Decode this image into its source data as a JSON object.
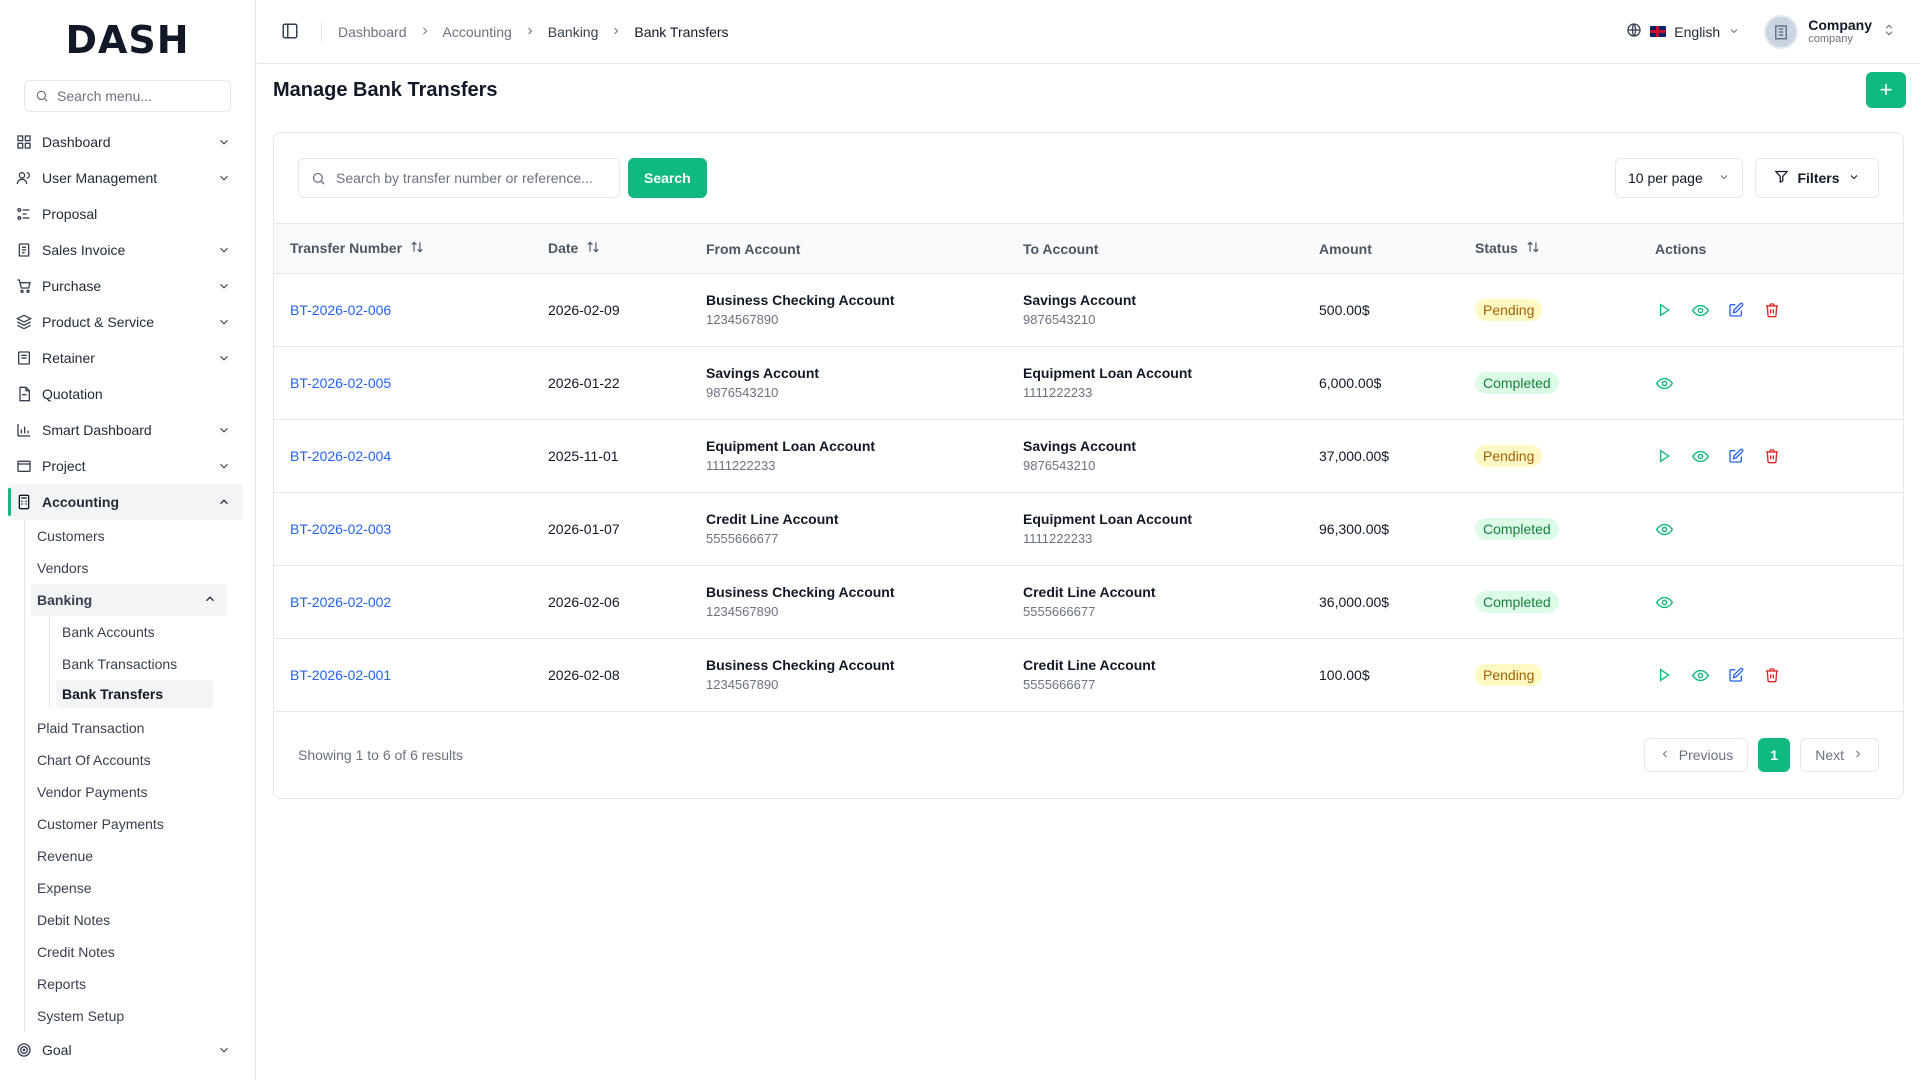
{
  "app": {
    "logo": "DASH"
  },
  "sidebar": {
    "search_placeholder": "Search menu...",
    "items": [
      {
        "label": "Dashboard",
        "icon": "dashboard-icon",
        "has_chevron": true
      },
      {
        "label": "User Management",
        "icon": "users-icon",
        "has_chevron": true
      },
      {
        "label": "Proposal",
        "icon": "proposal-icon",
        "has_chevron": false
      },
      {
        "label": "Sales Invoice",
        "icon": "invoice-icon",
        "has_chevron": true
      },
      {
        "label": "Purchase",
        "icon": "cart-icon",
        "has_chevron": true
      },
      {
        "label": "Product & Service",
        "icon": "layers-icon",
        "has_chevron": true
      },
      {
        "label": "Retainer",
        "icon": "retainer-icon",
        "has_chevron": true
      },
      {
        "label": "Quotation",
        "icon": "quotation-icon",
        "has_chevron": false
      },
      {
        "label": "Smart Dashboard",
        "icon": "chart-icon",
        "has_chevron": true
      },
      {
        "label": "Project",
        "icon": "folder-icon",
        "has_chevron": true
      },
      {
        "label": "Accounting",
        "icon": "calculator-icon",
        "has_chevron": true
      }
    ],
    "accounting_sub": {
      "customers": "Customers",
      "vendors": "Vendors",
      "banking": "Banking",
      "banking_sub": [
        "Bank Accounts",
        "Bank Transactions",
        "Bank Transfers"
      ],
      "rest": [
        "Plaid Transaction",
        "Chart Of Accounts",
        "Vendor Payments",
        "Customer Payments",
        "Revenue",
        "Expense",
        "Debit Notes",
        "Credit Notes",
        "Reports",
        "System Setup"
      ]
    },
    "goal": "Goal"
  },
  "header": {
    "breadcrumbs": [
      "Dashboard",
      "Accounting",
      "Banking",
      "Bank Transfers"
    ],
    "language": "English",
    "company_name": "Company",
    "company_role": "company"
  },
  "page": {
    "title": "Manage Bank Transfers",
    "add_label": "+",
    "search_placeholder": "Search by transfer number or reference...",
    "search_button": "Search",
    "per_page": "10 per page",
    "filters": "Filters"
  },
  "table": {
    "headers": {
      "transfer_number": "Transfer Number",
      "date": "Date",
      "from": "From Account",
      "to": "To Account",
      "amount": "Amount",
      "status": "Status",
      "actions": "Actions"
    },
    "rows": [
      {
        "number": "BT-2026-02-006",
        "date": "2026-02-09",
        "from_name": "Business Checking Account",
        "from_num": "1234567890",
        "to_name": "Savings Account",
        "to_num": "9876543210",
        "amount": "500.00$",
        "status": "Pending"
      },
      {
        "number": "BT-2026-02-005",
        "date": "2026-01-22",
        "from_name": "Savings Account",
        "from_num": "9876543210",
        "to_name": "Equipment Loan Account",
        "to_num": "1111222233",
        "amount": "6,000.00$",
        "status": "Completed"
      },
      {
        "number": "BT-2026-02-004",
        "date": "2025-11-01",
        "from_name": "Equipment Loan Account",
        "from_num": "1111222233",
        "to_name": "Savings Account",
        "to_num": "9876543210",
        "amount": "37,000.00$",
        "status": "Pending"
      },
      {
        "number": "BT-2026-02-003",
        "date": "2026-01-07",
        "from_name": "Credit Line Account",
        "from_num": "5555666677",
        "to_name": "Equipment Loan Account",
        "to_num": "1111222233",
        "amount": "96,300.00$",
        "status": "Completed"
      },
      {
        "number": "BT-2026-02-002",
        "date": "2026-02-06",
        "from_name": "Business Checking Account",
        "from_num": "1234567890",
        "to_name": "Credit Line Account",
        "to_num": "5555666677",
        "amount": "36,000.00$",
        "status": "Completed"
      },
      {
        "number": "BT-2026-02-001",
        "date": "2026-02-08",
        "from_name": "Business Checking Account",
        "from_num": "1234567890",
        "to_name": "Credit Line Account",
        "to_num": "5555666677",
        "amount": "100.00$",
        "status": "Pending"
      }
    ]
  },
  "pagination": {
    "showing": "Showing 1 to 6 of 6 results",
    "previous": "Previous",
    "current": "1",
    "next": "Next"
  },
  "colors": {
    "accent": "#10b981",
    "link": "#2563eb",
    "pending_bg": "#fef9c3",
    "completed_bg": "#dcfce7",
    "delete": "#dc2626"
  }
}
